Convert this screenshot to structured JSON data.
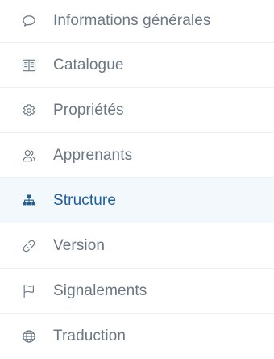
{
  "colors": {
    "text_default": "#6b7785",
    "text_active": "#1f5f99",
    "active_background": "#f2f8fc",
    "divider": "#eef0f3"
  },
  "menu": {
    "active_index": 4,
    "items": [
      {
        "label": "Informations générales",
        "icon": "speech-bubble-icon"
      },
      {
        "label": "Catalogue",
        "icon": "open-book-icon"
      },
      {
        "label": "Propriétés",
        "icon": "gear-icon"
      },
      {
        "label": "Apprenants",
        "icon": "users-icon"
      },
      {
        "label": "Structure",
        "icon": "sitemap-icon"
      },
      {
        "label": "Version",
        "icon": "link-icon"
      },
      {
        "label": "Signalements",
        "icon": "flag-icon"
      },
      {
        "label": "Traduction",
        "icon": "globe-icon"
      }
    ]
  }
}
